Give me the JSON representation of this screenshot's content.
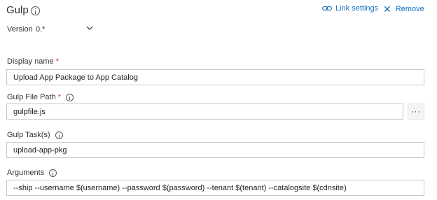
{
  "task": {
    "title": "Gulp",
    "link_settings_label": "Link settings",
    "remove_label": "Remove",
    "version_label": "Version",
    "version_value": "0.*"
  },
  "fields": {
    "display_name": {
      "label": "Display name",
      "required_marker": "*",
      "value": "Upload App Package to App Catalog"
    },
    "gulp_file_path": {
      "label": "Gulp File Path",
      "required_marker": "*",
      "value": "gulpfile.js",
      "browse_label": "···"
    },
    "gulp_tasks": {
      "label": "Gulp Task(s)",
      "value": "upload-app-pkg"
    },
    "arguments": {
      "label": "Arguments",
      "value": "--ship --username $(username) --password $(password) --tenant $(tenant) --catalogsite $(cdnsite)"
    }
  },
  "colors": {
    "link": "#106ebe",
    "required": "#c4314b",
    "border": "#c8c8c8"
  },
  "icons": [
    "info-icon",
    "link-icon",
    "close-icon",
    "chevron-down-icon"
  ]
}
